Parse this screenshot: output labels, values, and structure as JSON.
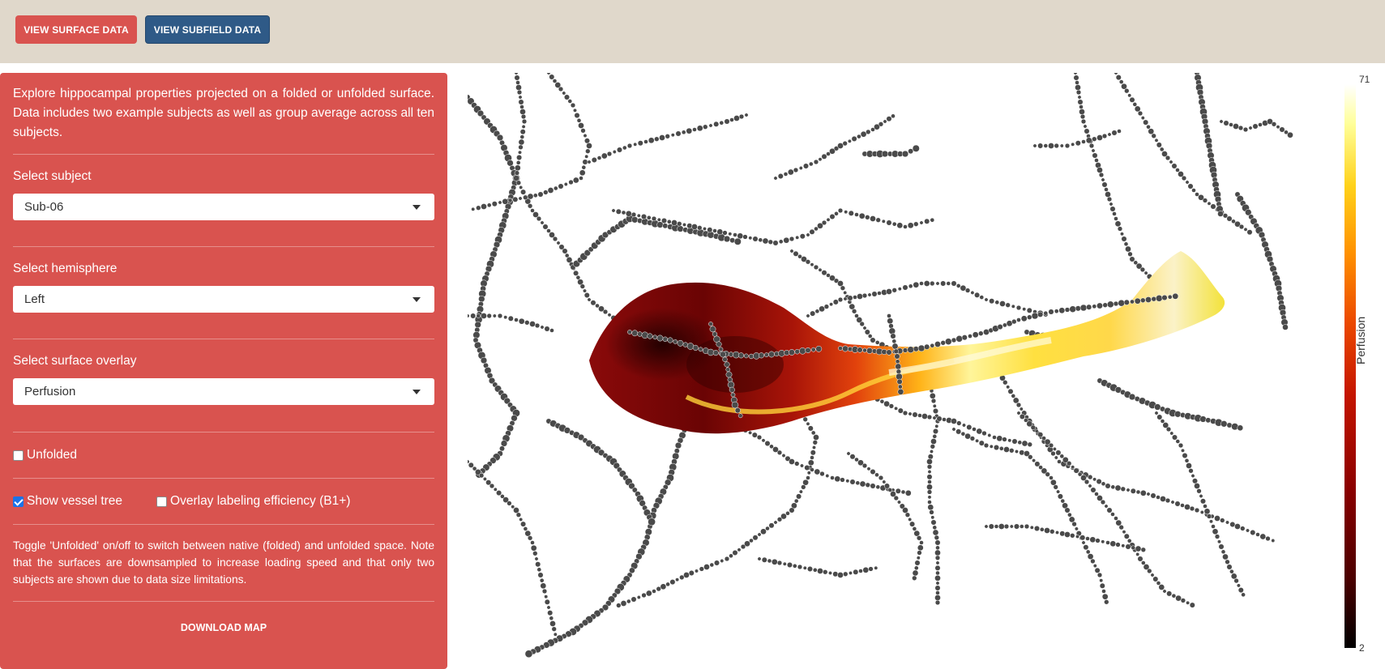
{
  "header": {
    "surface_button": "VIEW SURFACE DATA",
    "subfield_button": "VIEW SUBFIELD DATA"
  },
  "panel": {
    "intro": "Explore hippocampal properties projected on a folded or unfolded surface. Data includes two example subjects as well as group average across all ten subjects.",
    "subject_label": "Select subject",
    "subject_value": "Sub-06",
    "hemisphere_label": "Select hemisphere",
    "hemisphere_value": "Left",
    "overlay_label": "Select surface overlay",
    "overlay_value": "Perfusion",
    "unfolded_label": "Unfolded",
    "unfolded_checked": false,
    "vessel_label": "Show vessel tree",
    "vessel_checked": true,
    "efficiency_label": "Overlay labeling efficiency (B1+)",
    "efficiency_checked": false,
    "note": "Toggle 'Unfolded' on/off to switch between native (folded) and unfolded space. Note that the surfaces are downsampled to increase loading speed and that only two subjects are shown due to data size limitations.",
    "download": "DOWNLOAD MAP"
  },
  "colorbar": {
    "title": "Perfusion",
    "max": "71",
    "min": "2"
  },
  "colors": {
    "panel": "#d9534f",
    "surface_button": "#d9534f",
    "subfield_button": "#2f5a87",
    "topbar": "#e0d8cb"
  }
}
